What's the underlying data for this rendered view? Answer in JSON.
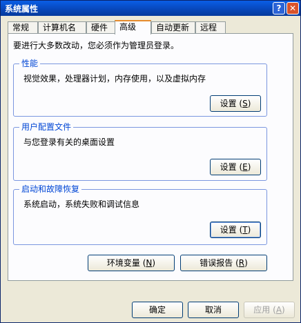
{
  "window": {
    "title": "系统属性",
    "help_glyph": "?",
    "close_glyph": "✕"
  },
  "tabs": [
    {
      "label": "常规"
    },
    {
      "label": "计算机名"
    },
    {
      "label": "硬件"
    },
    {
      "label": "高级"
    },
    {
      "label": "自动更新"
    },
    {
      "label": "远程"
    }
  ],
  "intro": "要进行大多数改动，您必须作为管理员登录。",
  "groups": {
    "performance": {
      "title": "性能",
      "desc": "视觉效果，处理器计划，内存使用，以及虚拟内存",
      "button": "设置",
      "key": "S"
    },
    "profiles": {
      "title": "用户配置文件",
      "desc": "与您登录有关的桌面设置",
      "button": "设置",
      "key": "E"
    },
    "startup": {
      "title": "启动和故障恢复",
      "desc": "系统启动，系统失败和调试信息",
      "button": "设置",
      "key": "T"
    }
  },
  "env_button": {
    "label": "环境变量",
    "key": "N"
  },
  "error_button": {
    "label": "错误报告",
    "key": "R"
  },
  "footer": {
    "ok": "确定",
    "cancel": "取消",
    "apply": "应用",
    "apply_key": "A"
  },
  "paren_open": "(",
  "paren_close": ")"
}
